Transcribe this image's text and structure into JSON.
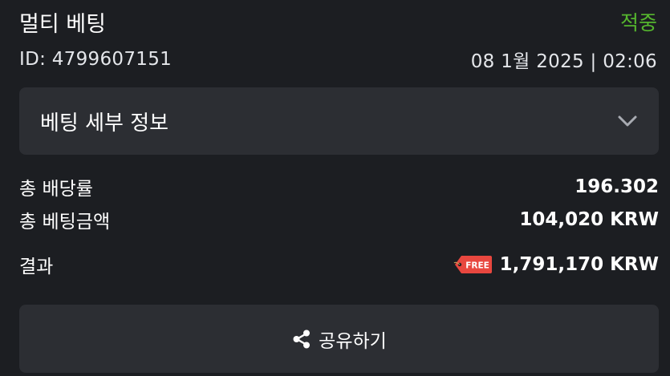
{
  "header": {
    "title": "멀티 베팅",
    "status": "적중",
    "status_color": "#55b62e",
    "bet_id": "ID: 4799607151",
    "datetime": "08 1월 2025 | 02:06"
  },
  "details": {
    "label": "베팅 세부 정보",
    "expand_icon": "chevron-down-icon"
  },
  "summary": {
    "odds_label": "총 배당률",
    "odds_value": "196.302",
    "stake_label": "총 베팅금액",
    "stake_value": "104,020 KRW",
    "result_label": "결과",
    "result_value": "1,791,170 KRW",
    "free_tag_text": "FREE",
    "free_tag_icon": "free-tag-icon"
  },
  "share": {
    "label": "공유하기",
    "icon": "share-icon"
  }
}
